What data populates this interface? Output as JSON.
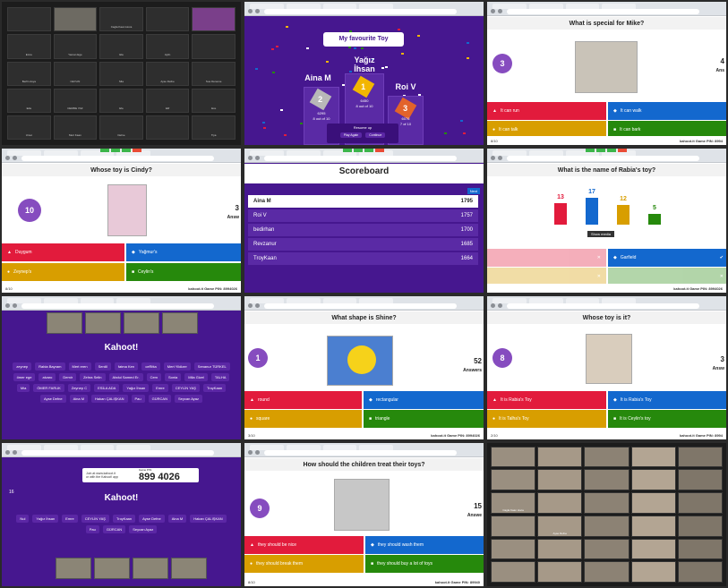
{
  "zoom_gallery": {
    "participants": [
      "",
      "",
      "Cagla Kaan Hoca",
      "",
      "",
      "Emre",
      "Yaman Ege",
      "Ela",
      "Aylin",
      "",
      "Berfin Asya",
      "CEYLIN",
      "Mia",
      "Ayse Defne",
      "Sue Deneme",
      "Eda",
      "CEMRE YAZ",
      "Efe",
      "Elif",
      "Ece",
      "Umut",
      "Mert Kaan",
      "Defne",
      "",
      "Tiya"
    ]
  },
  "podium": {
    "title": "My favourite Toy",
    "first": {
      "name": "Yağız İhsan",
      "rank": "1",
      "score": "6450",
      "detail": "8 out of 10"
    },
    "second": {
      "name": "Aina M",
      "rank": "2",
      "score": "6295",
      "detail": "8 out of 10"
    },
    "third": {
      "name": "Roi V",
      "rank": "3",
      "score": "6076",
      "detail": "7 of 10"
    },
    "buttons": {
      "label": "Resume up",
      "left": "Play Again",
      "right": "Continue"
    }
  },
  "q_mike": {
    "question": "What is special for Mike?",
    "timer": "3",
    "side_count": "4",
    "side_label": "Ans",
    "answers": [
      "It can run",
      "It can walk",
      "It can talk",
      "It can bark"
    ],
    "counter": "8/10",
    "pin_label": "kahoot.it Game PIN: 8994"
  },
  "q_cindy": {
    "question": "Whose toy is Cindy?",
    "timer": "10",
    "side_count": "3",
    "side_label": "Answ",
    "answers": [
      "Duygum",
      "Yağmur's",
      "Zeynep's",
      "Ceylin's"
    ],
    "counter": "8/10",
    "pin_label": "kahoot.it Game PIN: 8994026"
  },
  "scoreboard": {
    "title": "Scoreboard",
    "rows": [
      {
        "name": "Aina M",
        "score": "1795"
      },
      {
        "name": "Roi V",
        "score": "1757"
      },
      {
        "name": "bedirhan",
        "score": "1700"
      },
      {
        "name": "Revzanur",
        "score": "1685"
      },
      {
        "name": "TroyKaan",
        "score": "1664"
      }
    ],
    "next": "Next"
  },
  "results": {
    "question": "What is the name of Rabia's toy?",
    "counts": [
      "13",
      "17",
      "12",
      "5"
    ],
    "show_media": "Show media",
    "answers": [
      "",
      "Garfield",
      "",
      ""
    ],
    "counter": "",
    "pin_label": "kahoot.it Game PIN: 8994026"
  },
  "lobby1": {
    "logo": "Kahoot!",
    "players": [
      "zeynep",
      "Rabia Bayram",
      "Mert eren",
      "Serdil",
      "fatma Kerı",
      "ceRitta",
      "Mert Yildizer",
      "Senanur TÜRKEL",
      "ömer ege",
      "alvaro",
      "Demir",
      "Zehra Selin",
      "Abdul Samed Er.",
      "Cem",
      "Sonia",
      "Mila Gizel",
      "TALHA",
      "Mia",
      "ÖMER FARUK",
      "Zeynep C",
      "ESİLA ADA",
      "Yağız İhsan",
      "Emre",
      "CEYLİN YAŞ",
      "TroyKaan",
      "Ayse Defne",
      "Aina M",
      "Hakan ÇALIŞKAN",
      "Pau",
      "GÜRCAN",
      "Seycan Ayaz"
    ]
  },
  "q_shine": {
    "question": "What shape is Shine?",
    "timer": "1",
    "side_count": "52",
    "side_label": "Answers",
    "answers": [
      "round",
      "rectangular",
      "square",
      "triangle"
    ],
    "counter": "3/10",
    "pin_label": "kahoot.it Game PIN: 8994026"
  },
  "q_whose": {
    "question": "Whose toy is it?",
    "timer": "8",
    "side_count": "3",
    "side_label": "Answ",
    "answers": [
      "It is Rabia's Toy",
      "It is Rabia's Toy",
      "It is Talha's Toy",
      "It is Ceylin's toy"
    ],
    "counter": "2/10",
    "pin_label": "kahoot.it Game PIN: 8994"
  },
  "lobby2": {
    "pin_label_1": "Join at www.kahoot.it",
    "pin_label_2": "or with the Kahoot! app",
    "game_pin_caption": "Game PIN:",
    "pin": "899 4026",
    "logo": "Kahoot!",
    "count": "16",
    "players": [
      "Nul",
      "Yağız İhsan",
      "Emre",
      "CEYLİN YAŞ",
      "TroyKaan",
      "Ayse Defne",
      "Aina M",
      "Hakan ÇALIŞKAN",
      "Pau",
      "GÜRCAN",
      "Seycan Ayaz"
    ]
  },
  "q_treat": {
    "question": "How should the children treat their toys?",
    "timer": "9",
    "side_count": "15",
    "side_label": "Answe",
    "answers": [
      "they should be nice",
      "they should wash them",
      "they should break them",
      "they should buy a lot of toys"
    ],
    "counter": "8/10",
    "pin_label": "kahoot.it Game PIN: 89940"
  },
  "final_gallery": {
    "participants": [
      "",
      "",
      "",
      "",
      "",
      "",
      "",
      "",
      "",
      "",
      "Cagla Kaan Hoca",
      "",
      "",
      "",
      "",
      "",
      "Ayse Defne",
      "",
      "",
      "",
      "",
      "",
      "",
      "",
      "",
      "",
      "",
      "",
      "",
      ""
    ]
  },
  "colors": {
    "kahoot_purple": "#46178f",
    "red": "#e21b3c",
    "blue": "#1368ce",
    "yellow": "#d89e00",
    "green": "#26890c",
    "timer": "#864cbf"
  }
}
